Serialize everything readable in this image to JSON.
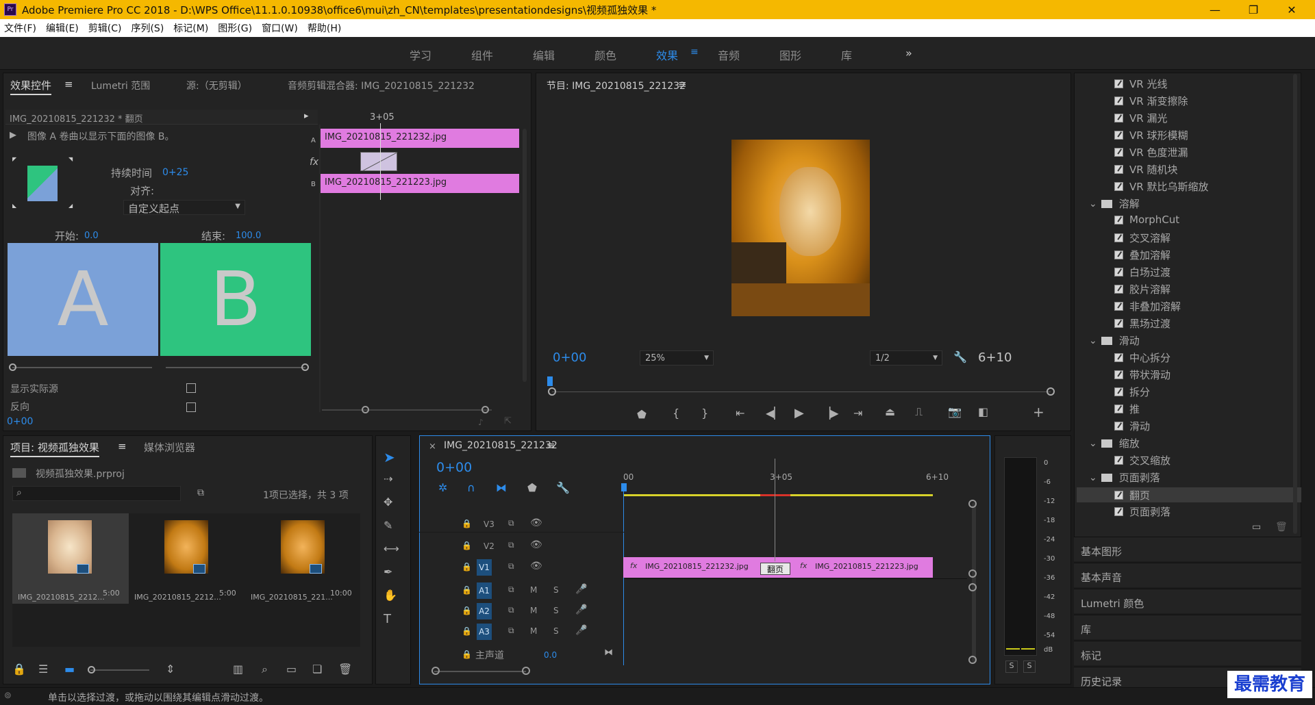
{
  "app": {
    "title": "Adobe Premiere Pro CC 2018 - D:\\WPS Office\\11.1.0.10938\\office6\\mui\\zh_CN\\templates\\presentationdesigns\\视频孤独效果 *",
    "logo": "Pr"
  },
  "window_controls": {
    "minimize": "—",
    "maximize": "❐",
    "close": "✕"
  },
  "menu": [
    "文件(F)",
    "编辑(E)",
    "剪辑(C)",
    "序列(S)",
    "标记(M)",
    "图形(G)",
    "窗口(W)",
    "帮助(H)"
  ],
  "workspaces": [
    "学习",
    "组件",
    "编辑",
    "颜色",
    "效果",
    "音频",
    "图形",
    "库"
  ],
  "workspace_active": "效果",
  "workspace_more": "»",
  "effect_controls": {
    "tabs": [
      "效果控件",
      "Lumetri 范围",
      "源:（无剪辑）",
      "音频剪辑混合器: IMG_20210815_221232"
    ],
    "clip_label": "IMG_20210815_221232 * 翻页",
    "description": "图像 A 卷曲以显示下面的图像 B。",
    "duration_label": "持续时间",
    "duration_value": "0+25",
    "align_label": "对齐:",
    "align_value": "自定义起点",
    "start_label": "开始:",
    "start_value": "0.0",
    "end_label": "结束:",
    "end_value": "100.0",
    "letter_a": "A",
    "letter_b": "B",
    "show_actual_label": "显示实际源",
    "reverse_label": "反向",
    "timecode": "0+00",
    "mini_timeline": {
      "time": "3+05",
      "clip_a": "IMG_20210815_221232.jpg",
      "clip_b": "IMG_20210815_221223.jpg",
      "track_a": "A",
      "track_b": "B",
      "fx": "fx"
    }
  },
  "program_monitor": {
    "title": "节目: IMG_20210815_221232",
    "timecode": "0+00",
    "zoom": "25%",
    "resolution": "1/2",
    "duration": "6+10"
  },
  "project": {
    "tabs": [
      "项目: 视频孤独效果",
      "媒体浏览器"
    ],
    "file": "视频孤独效果.prproj",
    "selection": "1项已选择，共 3 项",
    "items": [
      {
        "name": "IMG_20210815_2212...",
        "duration": "5:00"
      },
      {
        "name": "IMG_20210815_2212...",
        "duration": "5:00"
      },
      {
        "name": "IMG_20210815_221...",
        "duration": "10:00"
      }
    ]
  },
  "timeline": {
    "title": "IMG_20210815_221232",
    "timecode": "0+00",
    "ruler": [
      "00",
      "3+05",
      "6+10"
    ],
    "video_tracks": [
      "V3",
      "V2",
      "V1"
    ],
    "audio_tracks": [
      "A1",
      "A2",
      "A3"
    ],
    "mute": "M",
    "solo": "S",
    "master_label": "主声道",
    "master_value": "0.0",
    "clip1": "IMG_20210815_221232.jpg",
    "clip2": "IMG_20210815_221223.jpg",
    "transition": "翻页",
    "fx": "fx"
  },
  "meter": {
    "scale": [
      "0",
      "-6",
      "-12",
      "-18",
      "-24",
      "-30",
      "-36",
      "-42",
      "-48",
      "-54",
      "dB"
    ],
    "solo": [
      "S",
      "S"
    ]
  },
  "effects_tree": [
    {
      "type": "item",
      "label": "VR 光线"
    },
    {
      "type": "item",
      "label": "VR 渐变擦除"
    },
    {
      "type": "item",
      "label": "VR 漏光"
    },
    {
      "type": "item",
      "label": "VR 球形模糊"
    },
    {
      "type": "item",
      "label": "VR 色度泄漏"
    },
    {
      "type": "item",
      "label": "VR 随机块"
    },
    {
      "type": "item",
      "label": "VR 默比乌斯缩放"
    },
    {
      "type": "folder",
      "label": "溶解"
    },
    {
      "type": "item",
      "label": "MorphCut"
    },
    {
      "type": "item",
      "label": "交叉溶解"
    },
    {
      "type": "item",
      "label": "叠加溶解"
    },
    {
      "type": "item",
      "label": "白场过渡"
    },
    {
      "type": "item",
      "label": "胶片溶解"
    },
    {
      "type": "item",
      "label": "非叠加溶解"
    },
    {
      "type": "item",
      "label": "黑场过渡"
    },
    {
      "type": "folder",
      "label": "滑动"
    },
    {
      "type": "item",
      "label": "中心拆分"
    },
    {
      "type": "item",
      "label": "带状滑动"
    },
    {
      "type": "item",
      "label": "拆分"
    },
    {
      "type": "item",
      "label": "推"
    },
    {
      "type": "item",
      "label": "滑动"
    },
    {
      "type": "folder",
      "label": "缩放"
    },
    {
      "type": "item",
      "label": "交叉缩放"
    },
    {
      "type": "folder",
      "label": "页面剥落"
    },
    {
      "type": "item",
      "label": "翻页",
      "selected": true
    },
    {
      "type": "item",
      "label": "页面剥落"
    }
  ],
  "right_sections": [
    "基本图形",
    "基本声音",
    "Lumetri 颜色",
    "库",
    "标记",
    "历史记录"
  ],
  "status": "单击以选择过渡，或拖动以围绕其编辑点滑动过渡。",
  "watermark": "最需教育",
  "colors": {
    "accent": "#2d8ceb",
    "titlebar": "#f5b800",
    "clip": "#e07be0",
    "a_block": "#7ba1d8",
    "b_block": "#2ec47f"
  }
}
